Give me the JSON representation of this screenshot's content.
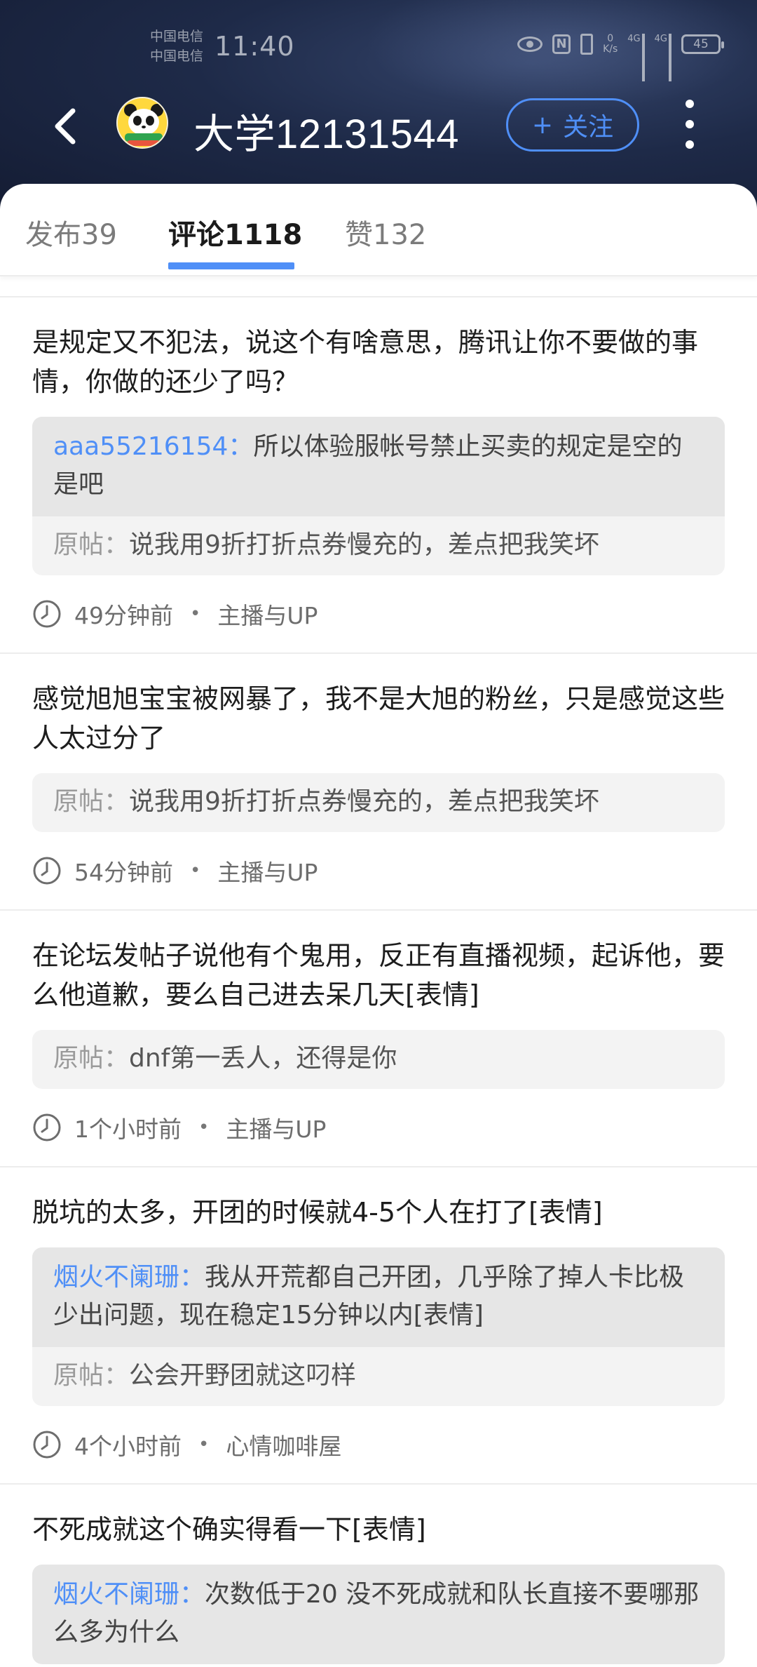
{
  "status_bar": {
    "carrier_1": "中国电信",
    "carrier_2": "中国电信",
    "time": "11:40",
    "speed_value": "0",
    "speed_unit": "K/s",
    "network_1": "4G",
    "network_2": "4G",
    "battery": "45"
  },
  "header": {
    "title": "大学12131544",
    "follow_label": "关注",
    "follow_plus": "+"
  },
  "tabs": [
    {
      "label": "发布39"
    },
    {
      "label": "评论1118"
    },
    {
      "label": "赞132"
    }
  ],
  "active_tab": "评论1118",
  "comments": [
    {
      "text": "是规定又不犯法，说这个有啥意思，腾讯让你不要做的事情，你做的还少了吗？",
      "reply_user": "aaa55216154",
      "reply_sep": "：",
      "reply_text": "所以体验服帐号禁止买卖的规定是空的是吧",
      "orig_label": "原帖：",
      "orig_text": "说我用9折打折点券慢充的，差点把我笑坏",
      "time": "49分钟前",
      "dot": "•",
      "board": "主播与UP"
    },
    {
      "text": "感觉旭旭宝宝被网暴了，我不是大旭的粉丝，只是感觉这些人太过分了",
      "orig_label": "原帖：",
      "orig_text": "说我用9折打折点券慢充的，差点把我笑坏",
      "time": "54分钟前",
      "dot": "•",
      "board": "主播与UP"
    },
    {
      "text": "在论坛发帖子说他有个鬼用，反正有直播视频，起诉他，要么他道歉，要么自己进去呆几天[表情]",
      "orig_label": "原帖：",
      "orig_text": "dnf第一丢人，还得是你",
      "time": "1个小时前",
      "dot": "•",
      "board": "主播与UP"
    },
    {
      "text": "脱坑的太多，开团的时候就4-5个人在打了[表情]",
      "reply_user": "烟火不阑珊",
      "reply_sep": "：",
      "reply_text": "我从开荒都自己开团，几乎除了掉人卡比极少出问题，现在稳定15分钟以内[表情]",
      "orig_label": "原帖：",
      "orig_text": "公会开野团就这叼样",
      "time": "4个小时前",
      "dot": "•",
      "board": "心情咖啡屋"
    },
    {
      "text": "不死成就这个确实得看一下[表情]",
      "reply_user": "烟火不阑珊",
      "reply_sep": "：",
      "reply_text": "次数低于20 没不死成就和队长直接不要哪那么多为什么"
    }
  ],
  "colors": {
    "accent": "#4f8ff7",
    "header_bg": "#1e2a48"
  }
}
